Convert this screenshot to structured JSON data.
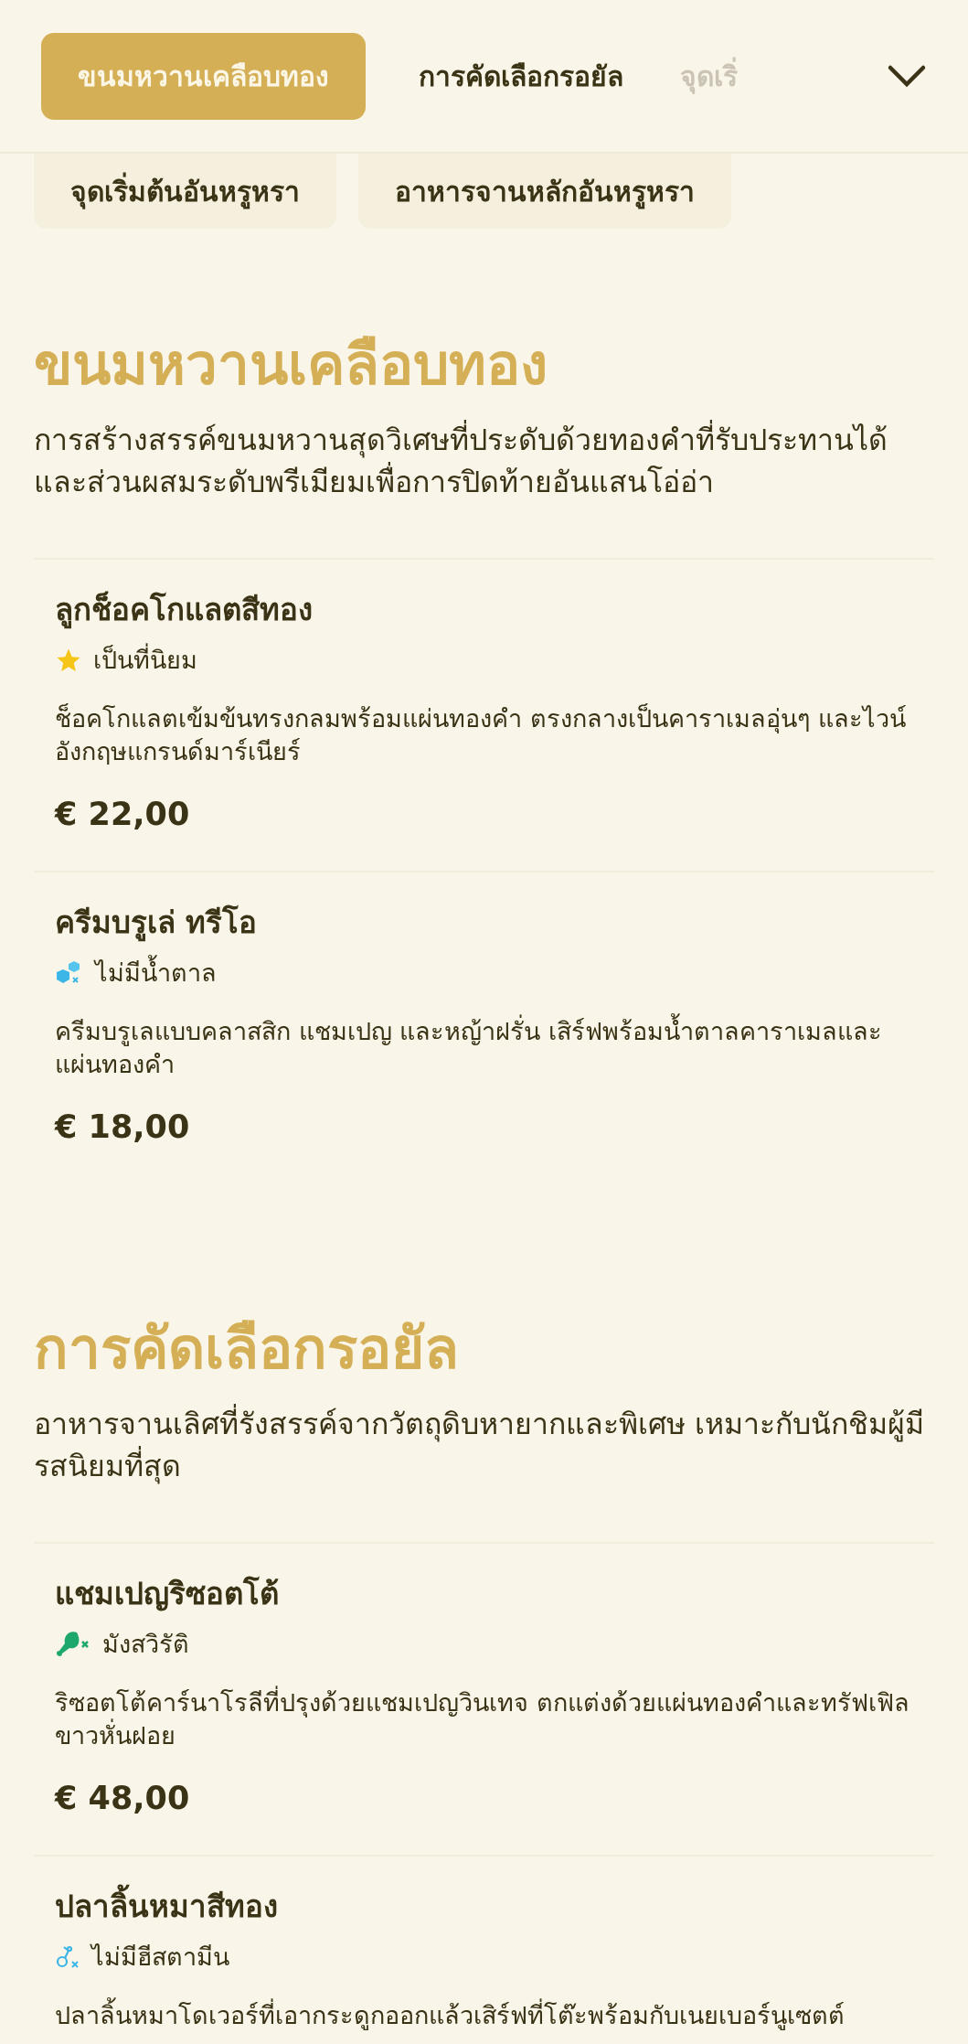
{
  "tabs": [
    {
      "label": "ขนมหวานเคลือบทอง",
      "selected": true
    },
    {
      "label": "การคัดเลือกรอยัล",
      "selected": false
    },
    {
      "label": "จุดเริ่",
      "selected": false
    }
  ],
  "subtabs": [
    {
      "label": "จุดเริ่มต้นอันหรูหรา"
    },
    {
      "label": "อาหารจานหลักอันหรูหรา"
    }
  ],
  "sections": [
    {
      "title": "ขนมหวานเคลือบทอง",
      "description": "การสร้างสรรค์ขนมหวานสุดวิเศษที่ประดับด้วยทองคำที่รับประทานได้และส่วนผสมระดับพรีเมียมเพื่อการปิดท้ายอันแสนโอ่อ่า",
      "items": [
        {
          "name": "ลูกช็อคโกแลตสีทอง",
          "tag": {
            "kind": "popular",
            "label": "เป็นที่นิยม"
          },
          "description": "ช็อคโกแลตเข้มข้นทรงกลมพร้อมแผ่นทองคำ ตรงกลางเป็นคาราเมลอุ่นๆ และไวน์อังกฤษแกรนด์มาร์เนียร์",
          "price": "€ 22,00"
        },
        {
          "name": "ครีมบรูเล่ ทรีโอ",
          "tag": {
            "kind": "sugar_free",
            "label": "ไม่มีน้ำตาล"
          },
          "description": "ครีมบรูเลแบบคลาสสิก แชมเปญ และหญ้าฝรั่น เสิร์ฟพร้อมน้ำตาลคาราเมลและแผ่นทองคำ",
          "price": "€ 18,00"
        }
      ]
    },
    {
      "title": "การคัดเลือกรอยัล",
      "description": "อาหารจานเลิศที่รังสรรค์จากวัตถุดิบหายากและพิเศษ เหมาะกับนักชิมผู้มีรสนิยมที่สุด",
      "items": [
        {
          "name": "แชมเปญริซอตโต้",
          "tag": {
            "kind": "vegetarian",
            "label": "มังสวิรัติ"
          },
          "description": "ริซอตโต้คาร์นาโรลีที่ปรุงด้วยแชมเปญวินเทจ ตกแต่งด้วยแผ่นทองคำและทรัฟเฟิลขาวหั่นฝอย",
          "price": "€ 48,00"
        },
        {
          "name": "ปลาลิ้นหมาสีทอง",
          "tag": {
            "kind": "histamine_free",
            "label": "ไม่มีฮีสตามีน"
          },
          "description": "ปลาลิ้นหมาโดเวอร์ที่เอากระดูกออกแล้วเสิร์ฟที่โต๊ะพร้อมกับเนยเบอร์นูเซตต์"
        }
      ]
    }
  ]
}
